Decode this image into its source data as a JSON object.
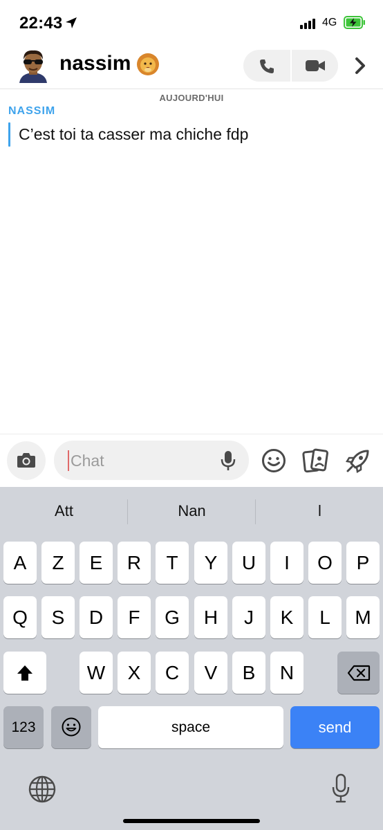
{
  "status_bar": {
    "time": "22:43",
    "network": "4G"
  },
  "header": {
    "contact_name": "nassim",
    "contact_emoji_icon": "lion-emoji-icon"
  },
  "conversation": {
    "date_label": "AUJOURD'HUI",
    "messages": [
      {
        "sender": "NASSIM",
        "text": "C’est toi ta casser ma  chiche fdp"
      }
    ]
  },
  "compose": {
    "placeholder": "Chat"
  },
  "keyboard": {
    "suggestions": [
      "Att",
      "Nan",
      "l"
    ],
    "row1": [
      "A",
      "Z",
      "E",
      "R",
      "T",
      "Y",
      "U",
      "I",
      "O",
      "P"
    ],
    "row2": [
      "Q",
      "S",
      "D",
      "F",
      "G",
      "H",
      "J",
      "K",
      "L",
      "M"
    ],
    "row3": [
      "W",
      "X",
      "C",
      "V",
      "B",
      "N"
    ],
    "numbers_label": "123",
    "space_label": "space",
    "send_label": "send"
  },
  "colors": {
    "accent_blue": "#3ea3ec",
    "send_blue": "#3b82f6",
    "keyboard_bg": "#d1d4da",
    "battery_green": "#3ec43a"
  }
}
